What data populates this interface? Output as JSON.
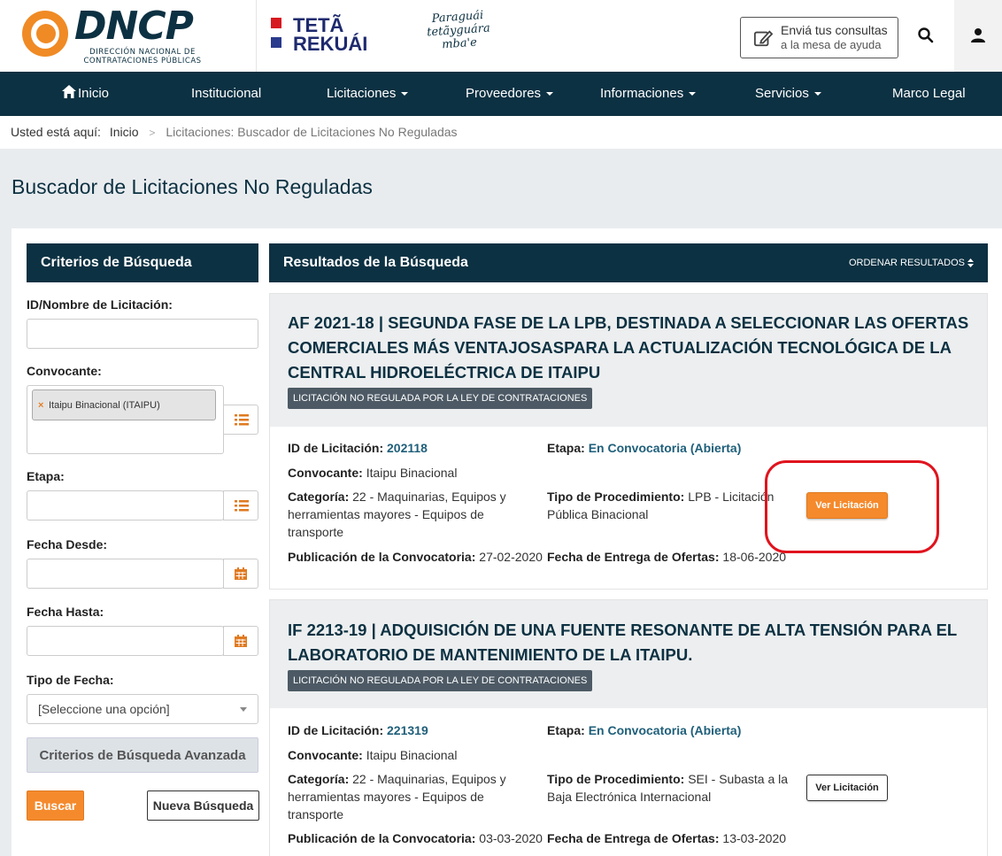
{
  "header": {
    "logo_text": "DNCP",
    "logo_sub": "DIRECCIÓN NACIONAL DE CONTRATACIONES PÚBLICAS",
    "teta_line1": "TETÃ",
    "teta_line2": "REKUÁI",
    "paraguai_line1": "Paraguái",
    "paraguai_line2": "tetãyguára",
    "paraguai_line3": "mba'e",
    "help_line1": "Enviá tus consultas",
    "help_line2": "a la mesa de ayuda",
    "search_icon": "search-icon",
    "user_icon": "user-icon"
  },
  "nav": {
    "items": [
      {
        "label": "Inicio",
        "icon": "home-icon",
        "dropdown": false
      },
      {
        "label": "Institucional",
        "dropdown": false
      },
      {
        "label": "Licitaciones",
        "dropdown": true
      },
      {
        "label": "Proveedores",
        "dropdown": true
      },
      {
        "label": "Informaciones",
        "dropdown": true
      },
      {
        "label": "Servicios",
        "dropdown": true
      },
      {
        "label": "Marco Legal",
        "dropdown": false
      }
    ],
    "color": "#0c3142"
  },
  "breadcrumb": {
    "prefix": "Usted está aquí:",
    "home": "Inicio",
    "current": "Licitaciones: Buscador de Licitaciones No Reguladas"
  },
  "page": {
    "title": "Buscador de Licitaciones No Reguladas"
  },
  "criteria": {
    "heading": "Criterios de Búsqueda",
    "id_label": "ID/Nombre de Licitación:",
    "id_value": "",
    "convocante_label": "Convocante:",
    "convocante_tag": "Itaipu Binacional (ITAIPU)",
    "etapa_label": "Etapa:",
    "fecha_desde_label": "Fecha Desde:",
    "fecha_hasta_label": "Fecha Hasta:",
    "tipo_fecha_label": "Tipo de Fecha:",
    "tipo_fecha_value": "[Seleccione una opción]",
    "advanced_button": "Criterios de Búsqueda Avanzada",
    "buscar_button": "Buscar",
    "nueva_button": "Nueva Búsqueda"
  },
  "results": {
    "heading": "Resultados de la Búsqueda",
    "order_label": "ORDENAR RESULTADOS",
    "items": [
      {
        "title": "AF 2021-18 | SEGUNDA FASE DE LA LPB, DESTINADA A SELECCIONAR LAS OFERTAS COMERCIALES MÁS VENTAJOSASPARA LA ACTUALIZACIÓN TECNOLÓGICA DE LA CENTRAL HIDROELÉCTRICA DE ITAIPU",
        "badge": "LICITACIÓN NO REGULADA POR LA LEY DE CONTRATACIONES",
        "id_label": "ID de Licitación:",
        "id_value": "202118",
        "convocante_label": "Convocante:",
        "convocante_value": "Itaipu Binacional",
        "categoria_label": "Categoría:",
        "categoria_value": "22 - Maquinarias, Equipos y herramientas mayores - Equipos de transporte",
        "publicacion_label": "Publicación de la Convocatoria:",
        "publicacion_value": "27-02-2020",
        "etapa_label": "Etapa:",
        "etapa_value": "En Convocatoria (Abierta)",
        "tipo_label": "Tipo de Procedimiento:",
        "tipo_value": "LPB - Licitación Pública Binacional",
        "entrega_label": "Fecha de Entrega de Ofertas:",
        "entrega_value": "18-06-2020",
        "button": "Ver Licitación"
      },
      {
        "title": "IF 2213-19 | ADQUISICIÓN DE UNA FUENTE RESONANTE DE ALTA TENSIÓN PARA EL LABORATORIO DE MANTENIMIENTO DE LA ITAIPU.",
        "badge": "LICITACIÓN NO REGULADA POR LA LEY DE CONTRATACIONES",
        "id_label": "ID de Licitación:",
        "id_value": "221319",
        "convocante_label": "Convocante:",
        "convocante_value": "Itaipu Binacional",
        "categoria_label": "Categoría:",
        "categoria_value": "22 - Maquinarias, Equipos y herramientas mayores - Equipos de transporte",
        "publicacion_label": "Publicación de la Convocatoria:",
        "publicacion_value": "03-03-2020",
        "etapa_label": "Etapa:",
        "etapa_value": "En Convocatoria (Abierta)",
        "tipo_label": "Tipo de Procedimiento:",
        "tipo_value": "SEI - Subasta a la Baja Electrónica Internacional",
        "entrega_label": "Fecha de Entrega de Ofertas:",
        "entrega_value": "13-03-2020",
        "button": "Ver Licitación"
      }
    ]
  },
  "colors": {
    "brand_dark": "#0c3142",
    "accent_orange": "#f58a2c",
    "highlight_red": "#e0141e",
    "link": "#1f5f7a"
  }
}
